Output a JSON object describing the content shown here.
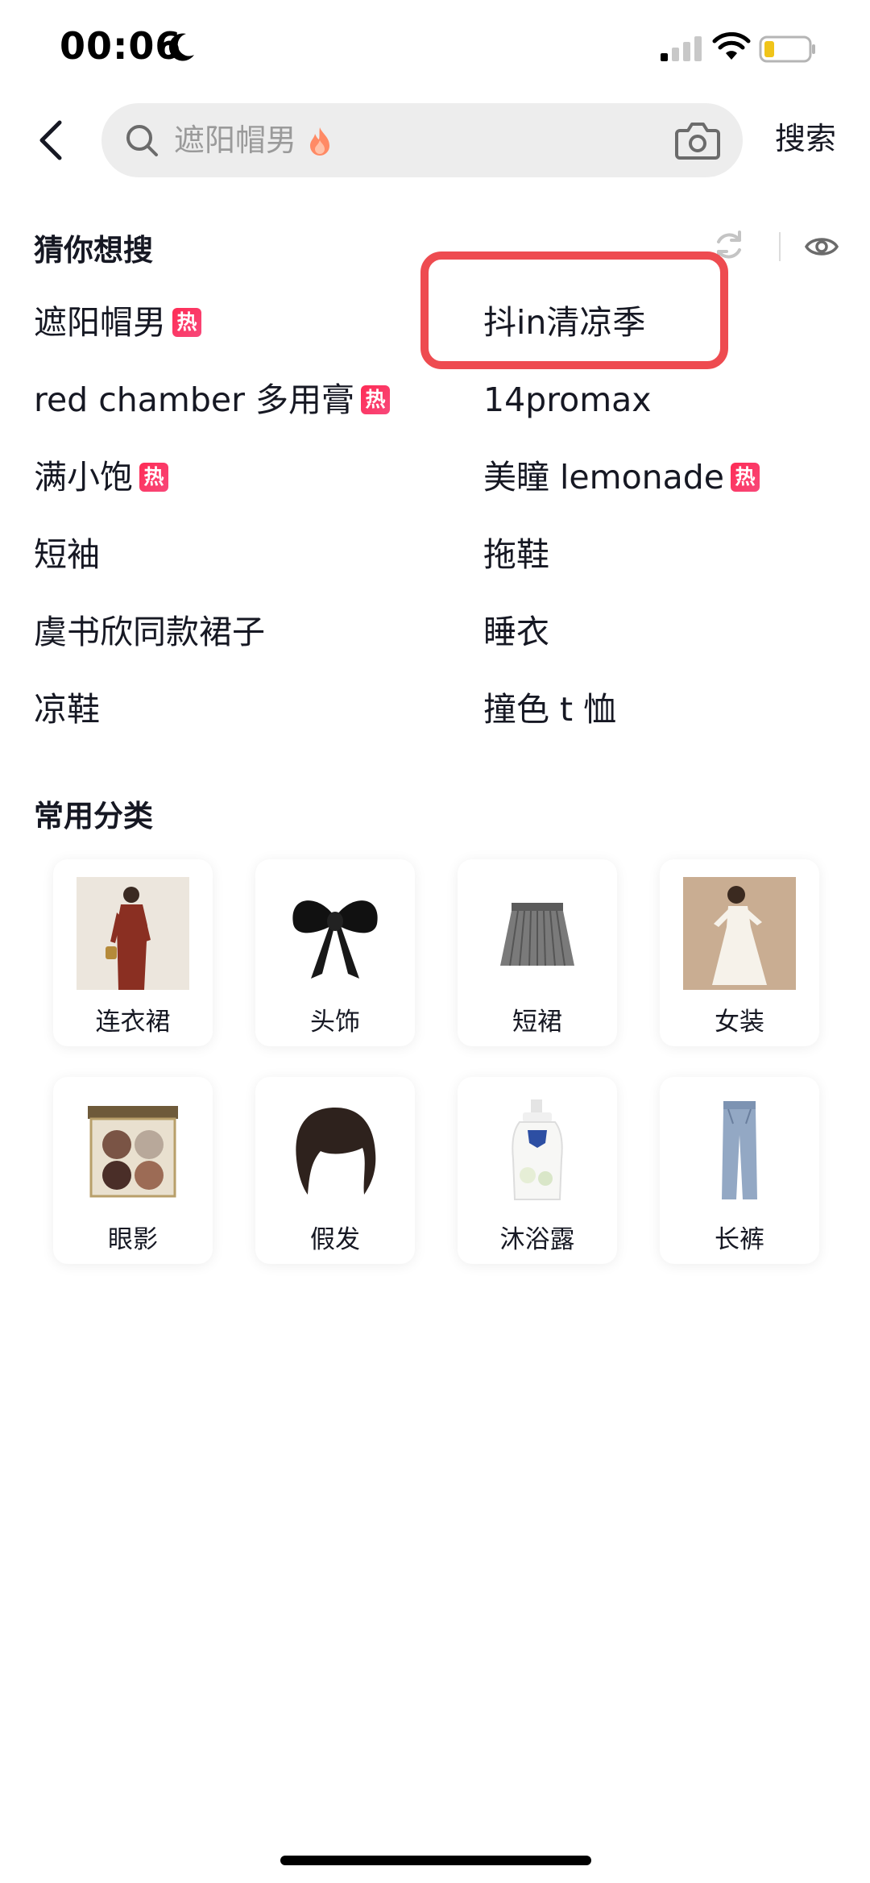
{
  "status_bar": {
    "time": "00:06"
  },
  "header": {
    "search_placeholder": "遮阳帽男",
    "search_button": "搜索"
  },
  "guess": {
    "title": "猜你想搜",
    "hot_label": "热",
    "left": [
      {
        "text": "遮阳帽男",
        "hot": true
      },
      {
        "text": "red chamber 多用膏",
        "hot": true
      },
      {
        "text": "满小饱",
        "hot": true
      },
      {
        "text": "短袖",
        "hot": false
      },
      {
        "text": "虞书欣同款裙子",
        "hot": false
      },
      {
        "text": "凉鞋",
        "hot": false
      }
    ],
    "right": [
      {
        "text": "抖in清凉季",
        "hot": false
      },
      {
        "text": "14promax",
        "hot": false
      },
      {
        "text": "美瞳 lemonade",
        "hot": true
      },
      {
        "text": "拖鞋",
        "hot": false
      },
      {
        "text": "睡衣",
        "hot": false
      },
      {
        "text": "撞色 t 恤",
        "hot": false
      }
    ]
  },
  "categories": {
    "title": "常用分类",
    "items": [
      {
        "label": "连衣裙",
        "icon": "dress-image"
      },
      {
        "label": "头饰",
        "icon": "bow-image"
      },
      {
        "label": "短裙",
        "icon": "pleated-skirt-image"
      },
      {
        "label": "女装",
        "icon": "womens-clothing-image"
      },
      {
        "label": "眼影",
        "icon": "eyeshadow-palette-image"
      },
      {
        "label": "假发",
        "icon": "wig-image"
      },
      {
        "label": "沐浴露",
        "icon": "body-wash-image"
      },
      {
        "label": "长裤",
        "icon": "jeans-image"
      }
    ]
  },
  "colors": {
    "accent_hot": "#fe2c55",
    "highlight_border": "#ee4b50",
    "search_bg": "#ededed"
  }
}
